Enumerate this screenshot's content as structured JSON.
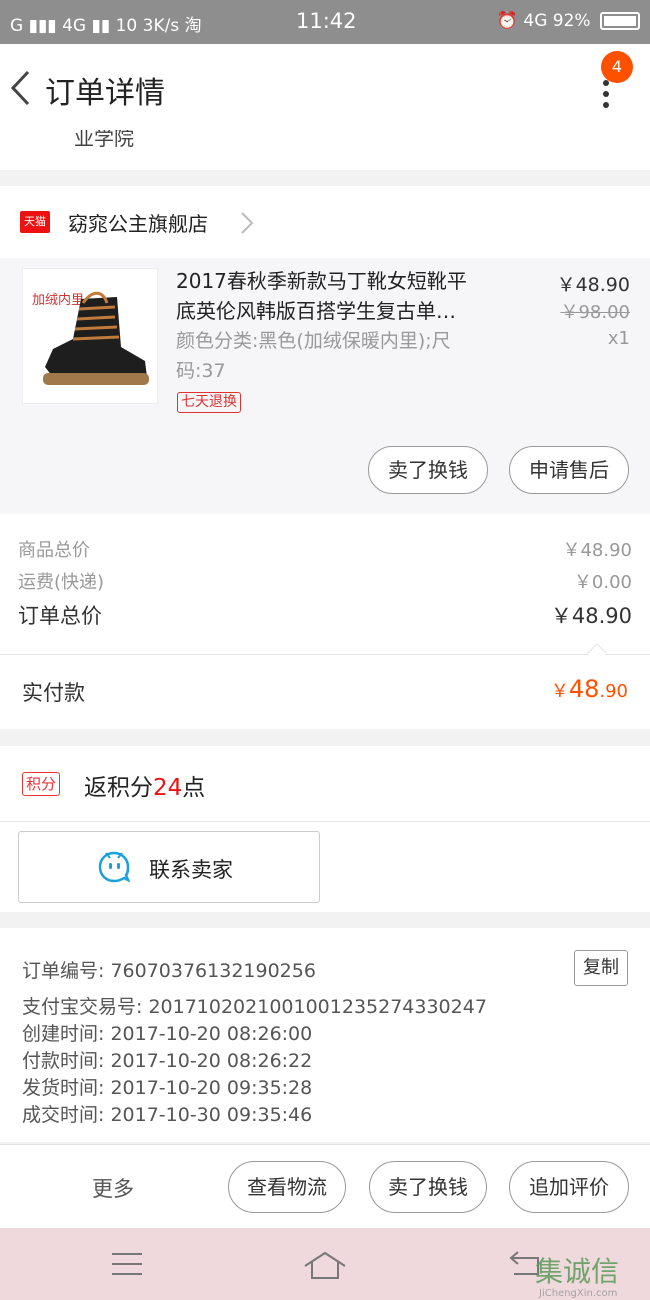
{
  "status_bar": {
    "signal_left": "G",
    "network1": "4G",
    "notif_count": "10",
    "speed": "3K/s",
    "app_badge": "淘",
    "time": "11:42",
    "network2": "4G",
    "battery": "92%"
  },
  "nav": {
    "title": "订单详情",
    "badge": "4"
  },
  "address_tail": "业学院",
  "shop": {
    "logo_text": "天猫",
    "name": "窈窕公主旗舰店"
  },
  "item": {
    "image_tag": "加绒内里",
    "title_line1": "2017春秋季新款马丁靴女短靴平",
    "title_line2": "底英伦风韩版百搭学生复古单…",
    "sku": "颜色分类:黑色(加绒保暖内里);尺码:37",
    "badge": "七天退换",
    "price": "￥48.90",
    "orig_price": "￥98.00",
    "qty": "x1",
    "btn_sell": "卖了换钱",
    "btn_after_sale": "申请售后"
  },
  "summary": {
    "goods_label": "商品总价",
    "goods_value": "￥48.90",
    "shipping_label": "运费(快递)",
    "shipping_value": "￥0.00",
    "order_total_label": "订单总价",
    "order_total_value": "￥48.90",
    "paid_label": "实付款",
    "paid_currency": "￥",
    "paid_int": "48",
    "paid_dec": ".90"
  },
  "points": {
    "tag": "积分",
    "text_prefix": "返积分",
    "amount": "24",
    "text_suffix": "点"
  },
  "contact": {
    "label": "联系卖家"
  },
  "order_info": {
    "order_no": "订单编号: 76070376132190256",
    "copy": "复制",
    "alipay_no": "支付宝交易号: 2017102021001001235274330247",
    "created": "创建时间: 2017-10-20  08:26:00",
    "paid": "付款时间: 2017-10-20  08:26:22",
    "shipped": "发货时间: 2017-10-20  09:35:28",
    "completed": "成交时间: 2017-10-30  09:35:46"
  },
  "actions": {
    "more": "更多",
    "logistics": "查看物流",
    "sell": "卖了换钱",
    "review": "追加评价"
  },
  "watermark": {
    "text": "集诚信",
    "sub": "JiChengXin.com"
  },
  "colors": {
    "accent": "#ff5000",
    "red": "#e11111",
    "status_bar": "#8e8e8e",
    "nav_bottom": "#efd9dc"
  }
}
